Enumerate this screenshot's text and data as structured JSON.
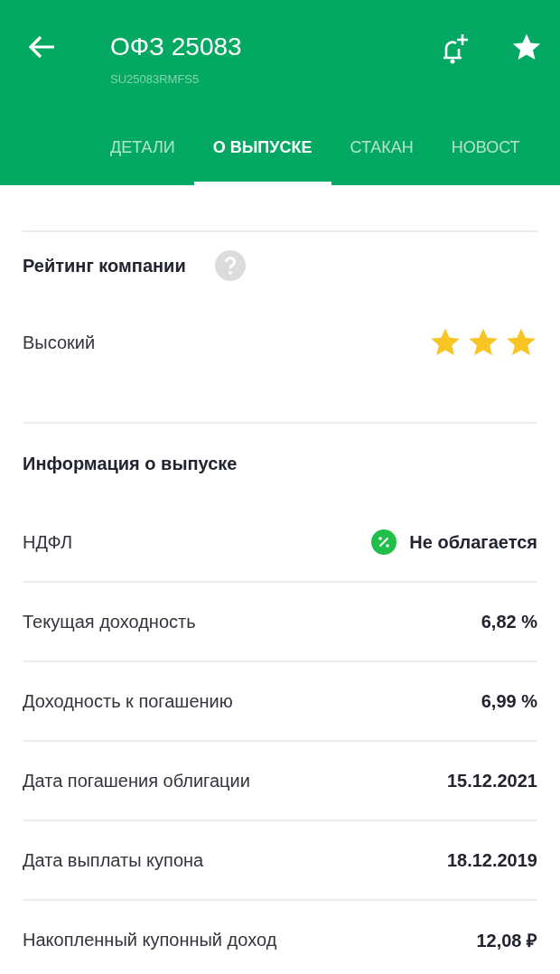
{
  "header": {
    "title": "ОФЗ 25083",
    "subtitle": "SU25083RMFS5"
  },
  "tabs": [
    {
      "label": "ДЕТАЛИ",
      "selected": false
    },
    {
      "label": "О ВЫПУСКЕ",
      "selected": true
    },
    {
      "label": "СТАКАН",
      "selected": false
    },
    {
      "label": "НОВОСТ",
      "selected": false
    }
  ],
  "rating": {
    "heading": "Рейтинг компании",
    "label": "Высокий",
    "stars": 3
  },
  "issue": {
    "heading": "Информация о выпуске",
    "rows": [
      {
        "kind": "tax",
        "label": "НДФЛ",
        "value": "Не облагается"
      },
      {
        "kind": "value",
        "label": "Текущая доходность",
        "value": "6,82 %"
      },
      {
        "kind": "value",
        "label": "Доходность к погашению",
        "value": "6,99 %"
      },
      {
        "kind": "value",
        "label": "Дата погашения облигации",
        "value": "15.12.2021"
      },
      {
        "kind": "value",
        "label": "Дата выплаты купона",
        "value": "18.12.2019"
      },
      {
        "kind": "value",
        "label": "Накопленный купонный доход",
        "value": "12,08 ₽"
      }
    ]
  }
}
